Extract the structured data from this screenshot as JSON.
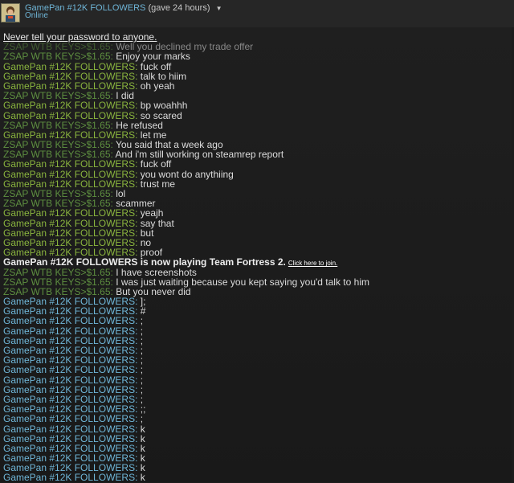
{
  "header": {
    "name": "GamePan #12K FOLLOWERS",
    "extra": "(gave 24 hours)",
    "status": "Online"
  },
  "colors": {
    "zsap": "#5e8f40",
    "gamepan_game": "#8ab53e",
    "gamepan_online": "#6fb6d8"
  },
  "warning": "Never tell your password to anyone.",
  "event": {
    "text": "GamePan #12K FOLLOWERS is now playing Team Fortress 2.",
    "link": "Click here to join."
  },
  "lines": [
    {
      "s": "ZSAP WTB KEYS>$1.65",
      "t": "Well you declined my trade offer",
      "c": "zsap",
      "faded": true
    },
    {
      "s": "ZSAP WTB KEYS>$1.65",
      "t": "Enjoy your marks",
      "c": "zsap"
    },
    {
      "s": "GamePan #12K FOLLOWERS",
      "t": "fuck off",
      "c": "gamepan_game"
    },
    {
      "s": "GamePan #12K FOLLOWERS",
      "t": "talk to hiim",
      "c": "gamepan_game"
    },
    {
      "s": "GamePan #12K FOLLOWERS",
      "t": "oh yeah",
      "c": "gamepan_game"
    },
    {
      "s": "ZSAP WTB KEYS>$1.65",
      "t": "I did",
      "c": "zsap"
    },
    {
      "s": "GamePan #12K FOLLOWERS",
      "t": "bp woahhh",
      "c": "gamepan_game"
    },
    {
      "s": "GamePan #12K FOLLOWERS",
      "t": "so scared",
      "c": "gamepan_game"
    },
    {
      "s": "ZSAP WTB KEYS>$1.65",
      "t": "He refused",
      "c": "zsap"
    },
    {
      "s": "GamePan #12K FOLLOWERS",
      "t": "let me",
      "c": "gamepan_game"
    },
    {
      "s": "ZSAP WTB KEYS>$1.65",
      "t": "You said that a week ago",
      "c": "zsap"
    },
    {
      "s": "ZSAP WTB KEYS>$1.65",
      "t": "And i'm still working on steamrep report",
      "c": "zsap"
    },
    {
      "s": "GamePan #12K FOLLOWERS",
      "t": "fuck off",
      "c": "gamepan_game"
    },
    {
      "s": "GamePan #12K FOLLOWERS",
      "t": "you wont do anythiing",
      "c": "gamepan_game"
    },
    {
      "s": "GamePan #12K FOLLOWERS",
      "t": "trust me",
      "c": "gamepan_game"
    },
    {
      "s": "ZSAP WTB KEYS>$1.65",
      "t": "lol",
      "c": "zsap"
    },
    {
      "s": "ZSAP WTB KEYS>$1.65",
      "t": "scammer",
      "c": "zsap"
    },
    {
      "s": "GamePan #12K FOLLOWERS",
      "t": "yeajh",
      "c": "gamepan_game"
    },
    {
      "s": "GamePan #12K FOLLOWERS",
      "t": "say that",
      "c": "gamepan_game"
    },
    {
      "s": "GamePan #12K FOLLOWERS",
      "t": "but",
      "c": "gamepan_game"
    },
    {
      "s": "GamePan #12K FOLLOWERS",
      "t": "no",
      "c": "gamepan_game"
    },
    {
      "s": "GamePan #12K FOLLOWERS",
      "t": "proof",
      "c": "gamepan_game"
    },
    {
      "event": true
    },
    {
      "s": "ZSAP WTB KEYS>$1.65",
      "t": "I have screenshots",
      "c": "zsap"
    },
    {
      "s": "ZSAP WTB KEYS>$1.65",
      "t": "I was just waiting because you kept saying you'd talk to him",
      "c": "zsap"
    },
    {
      "s": "ZSAP WTB KEYS>$1.65",
      "t": "But you never did",
      "c": "zsap"
    },
    {
      "s": "GamePan #12K FOLLOWERS",
      "t": "];",
      "c": "gamepan_online"
    },
    {
      "s": "GamePan #12K FOLLOWERS",
      "t": "#",
      "c": "gamepan_online"
    },
    {
      "s": "GamePan #12K FOLLOWERS",
      "t": ";",
      "c": "gamepan_online"
    },
    {
      "s": "GamePan #12K FOLLOWERS",
      "t": ";",
      "c": "gamepan_online"
    },
    {
      "s": "GamePan #12K FOLLOWERS",
      "t": ";",
      "c": "gamepan_online"
    },
    {
      "s": "GamePan #12K FOLLOWERS",
      "t": ";",
      "c": "gamepan_online"
    },
    {
      "s": "GamePan #12K FOLLOWERS",
      "t": ";",
      "c": "gamepan_online"
    },
    {
      "s": "GamePan #12K FOLLOWERS",
      "t": ";",
      "c": "gamepan_online"
    },
    {
      "s": "GamePan #12K FOLLOWERS",
      "t": ";",
      "c": "gamepan_online"
    },
    {
      "s": "GamePan #12K FOLLOWERS",
      "t": ";",
      "c": "gamepan_online"
    },
    {
      "s": "GamePan #12K FOLLOWERS",
      "t": ";",
      "c": "gamepan_online"
    },
    {
      "s": "GamePan #12K FOLLOWERS",
      "t": ";;",
      "c": "gamepan_online"
    },
    {
      "s": "GamePan #12K FOLLOWERS",
      "t": ";",
      "c": "gamepan_online"
    },
    {
      "s": "GamePan #12K FOLLOWERS",
      "t": "k",
      "c": "gamepan_online"
    },
    {
      "s": "GamePan #12K FOLLOWERS",
      "t": "k",
      "c": "gamepan_online"
    },
    {
      "s": "GamePan #12K FOLLOWERS",
      "t": "k",
      "c": "gamepan_online"
    },
    {
      "s": "GamePan #12K FOLLOWERS",
      "t": "k",
      "c": "gamepan_online"
    },
    {
      "s": "GamePan #12K FOLLOWERS",
      "t": "k",
      "c": "gamepan_online"
    },
    {
      "s": "GamePan #12K FOLLOWERS",
      "t": "k",
      "c": "gamepan_online"
    }
  ]
}
